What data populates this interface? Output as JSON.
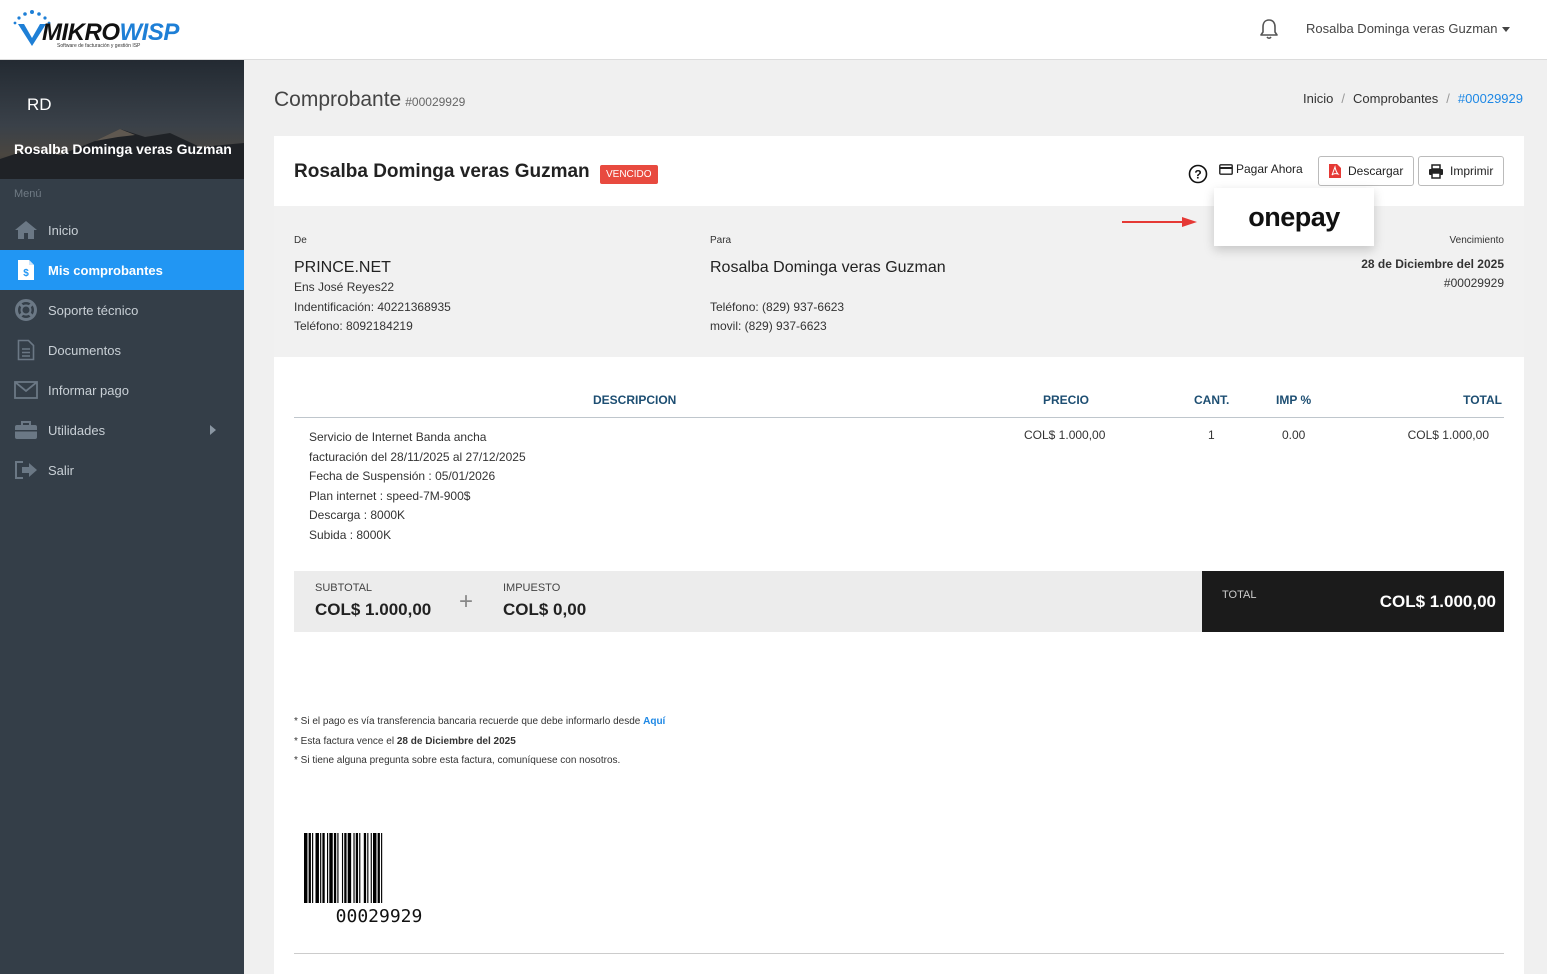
{
  "header": {
    "logo_brand_a": "MIKRO",
    "logo_brand_b": "WISP",
    "logo_tagline": "Software de facturación y gestión ISP",
    "user_name": "Rosalba Dominga veras Guzman"
  },
  "sidebar": {
    "initials": "RD",
    "profile_name": "Rosalba Dominga veras Guzman",
    "menu_label": "Menú",
    "items": [
      {
        "label": "Inicio",
        "icon": "home-icon"
      },
      {
        "label": "Mis comprobantes",
        "icon": "invoice-icon",
        "active": true
      },
      {
        "label": "Soporte técnico",
        "icon": "lifebuoy-icon"
      },
      {
        "label": "Documentos",
        "icon": "document-icon"
      },
      {
        "label": "Informar pago",
        "icon": "envelope-icon"
      },
      {
        "label": "Utilidades",
        "icon": "toolbox-icon",
        "has_submenu": true
      },
      {
        "label": "Salir",
        "icon": "sign-out-icon"
      }
    ]
  },
  "page": {
    "title": "Comprobante",
    "number": "#00029929",
    "breadcrumb": [
      "Inicio",
      "Comprobantes",
      "#00029929"
    ]
  },
  "invoice": {
    "client_name": "Rosalba Dominga veras Guzman",
    "status": "VENCIDO",
    "actions": {
      "pay": "Pagar Ahora",
      "download": "Descargar",
      "print": "Imprimir"
    },
    "onepay_label": "onepay",
    "from": {
      "label": "De",
      "company": "PRINCE.NET",
      "address": "Ens José Reyes22",
      "id": "Indentificación: 40221368935",
      "phone": "Teléfono: 8092184219"
    },
    "to": {
      "label": "Para",
      "name": "Rosalba Dominga veras Guzman",
      "phone": "Teléfono: (829) 937-6623",
      "mobile": "movil: (829) 937-6623"
    },
    "due": {
      "label": "Vencimiento",
      "date": "28 de Diciembre del 2025",
      "number": "#00029929"
    },
    "columns": {
      "description": "DESCRIPCION",
      "price": "PRECIO",
      "qty": "CANT.",
      "tax": "IMP %",
      "total": "TOTAL"
    },
    "items": [
      {
        "desc_lines": [
          "Servicio de Internet Banda ancha",
          "facturación del 28/11/2025 al 27/12/2025",
          "Fecha de Suspensión : 05/01/2026",
          "Plan internet : speed-7M-900$",
          "Descarga : 8000K",
          "Subida : 8000K"
        ],
        "price": "COL$ 1.000,00",
        "qty": "1",
        "tax": "0.00",
        "total": "COL$ 1.000,00"
      }
    ],
    "totals": {
      "subtotal_label": "SUBTOTAL",
      "subtotal": "COL$ 1.000,00",
      "plus": "+",
      "tax_label": "IMPUESTO",
      "tax": "COL$ 0,00",
      "total_label": "TOTAL",
      "total": "COL$ 1.000,00"
    },
    "notes": {
      "line1": "* Si el pago es vía transferencia bancaria recuerde que debe informarlo desde ",
      "line1_link": "Aquí",
      "line2_prefix": "* Esta factura vence el ",
      "line2_bold": "28 de Diciembre del 2025",
      "line3": "* Si tiene alguna pregunta sobre esta factura, comuníquese con nosotros."
    },
    "barcode_number": "00029929"
  },
  "colors": {
    "sidebar_bg": "#343e48",
    "active_item": "#2196f3",
    "badge": "#e84a3f",
    "link": "#1e88e5",
    "total_box": "#1b1b1b"
  }
}
